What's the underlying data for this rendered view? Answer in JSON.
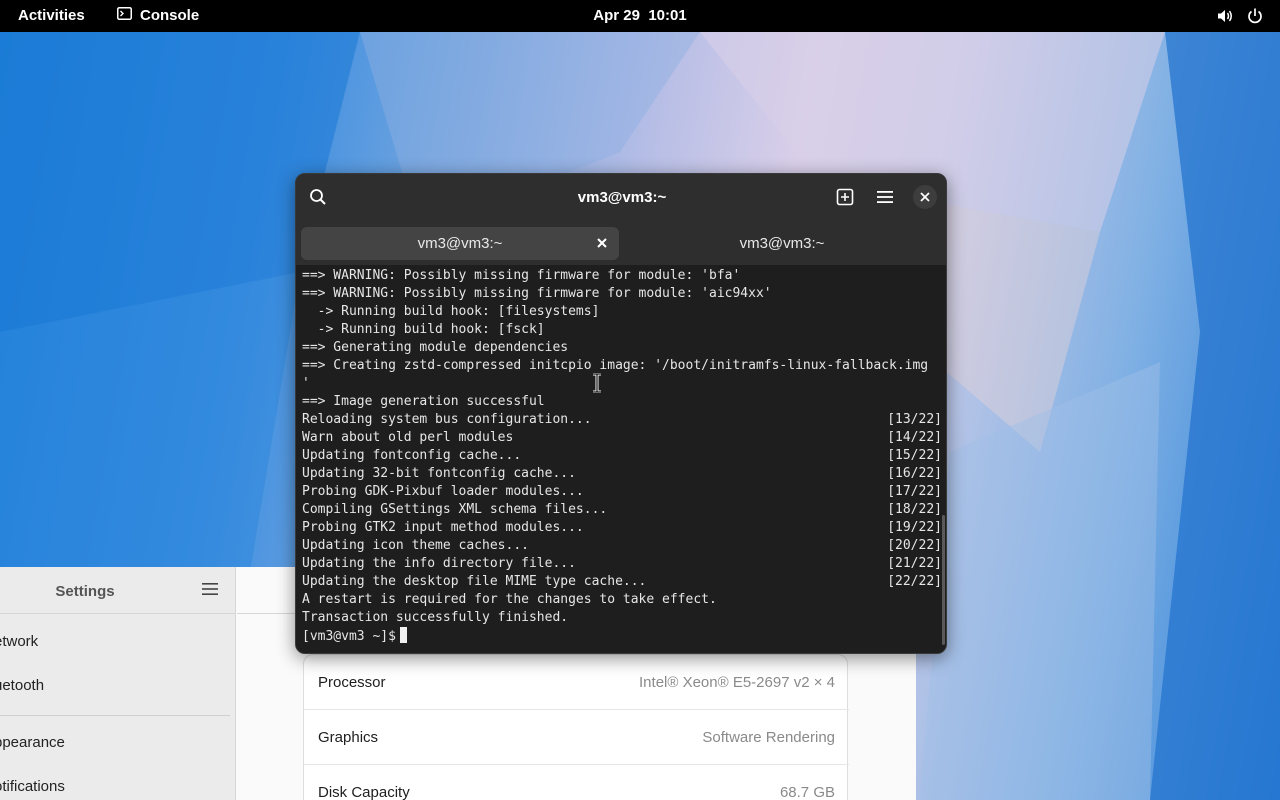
{
  "topbar": {
    "activities": "Activities",
    "app_name": "Console",
    "app_icon": "terminal-icon",
    "date": "Apr 29",
    "time": "10:01",
    "tray_icons": [
      "volume-icon",
      "power-icon"
    ]
  },
  "terminal": {
    "title": "vm3@vm3:~",
    "header_icons": [
      "search-icon",
      "new-tab-icon",
      "hamburger-menu-icon",
      "close-icon"
    ],
    "tabs": [
      {
        "label": "vm3@vm3:~",
        "active": true
      },
      {
        "label": "vm3@vm3:~",
        "active": false
      }
    ],
    "lines": [
      {
        "text": "==> WARNING: Possibly missing firmware for module: 'bfa'",
        "status": ""
      },
      {
        "text": "==> WARNING: Possibly missing firmware for module: 'aic94xx'",
        "status": ""
      },
      {
        "text": "  -> Running build hook: [filesystems]",
        "status": ""
      },
      {
        "text": "  -> Running build hook: [fsck]",
        "status": ""
      },
      {
        "text": "==> Generating module dependencies",
        "status": ""
      },
      {
        "text": "==> Creating zstd-compressed initcpio image: '/boot/initramfs-linux-fallback.img",
        "status": ""
      },
      {
        "text": "'",
        "status": ""
      },
      {
        "text": "==> Image generation successful",
        "status": ""
      },
      {
        "text": "Reloading system bus configuration...",
        "status": "[13/22]"
      },
      {
        "text": "Warn about old perl modules",
        "status": "[14/22]"
      },
      {
        "text": "Updating fontconfig cache...",
        "status": "[15/22]"
      },
      {
        "text": "Updating 32-bit fontconfig cache...",
        "status": "[16/22]"
      },
      {
        "text": "Probing GDK-Pixbuf loader modules...",
        "status": "[17/22]"
      },
      {
        "text": "Compiling GSettings XML schema files...",
        "status": "[18/22]"
      },
      {
        "text": "Probing GTK2 input method modules...",
        "status": "[19/22]"
      },
      {
        "text": "Updating icon theme caches...",
        "status": "[20/22]"
      },
      {
        "text": "Updating the info directory file...",
        "status": "[21/22]"
      },
      {
        "text": "Updating the desktop file MIME type cache...",
        "status": "[22/22]"
      },
      {
        "text": "A restart is required for the changes to take effect.",
        "status": ""
      },
      {
        "text": "Transaction successfully finished.",
        "status": ""
      }
    ],
    "prompt": "[vm3@vm3 ~]$"
  },
  "settings": {
    "title": "Settings",
    "sidebar_items": [
      "etwork",
      "uetooth",
      "ppearance",
      "otifications"
    ],
    "rows": [
      {
        "key": "Processor",
        "value": "Intel® Xeon® E5-2697 v2 × 4"
      },
      {
        "key": "Graphics",
        "value": "Software Rendering"
      },
      {
        "key": "Disk Capacity",
        "value": "68.7 GB"
      }
    ]
  },
  "colors": {
    "topbar_bg": "#000000",
    "terminal_bg": "#1e1e1e",
    "terminal_header": "#2e2e2e",
    "desktop_accent": "#3b8ee0"
  }
}
